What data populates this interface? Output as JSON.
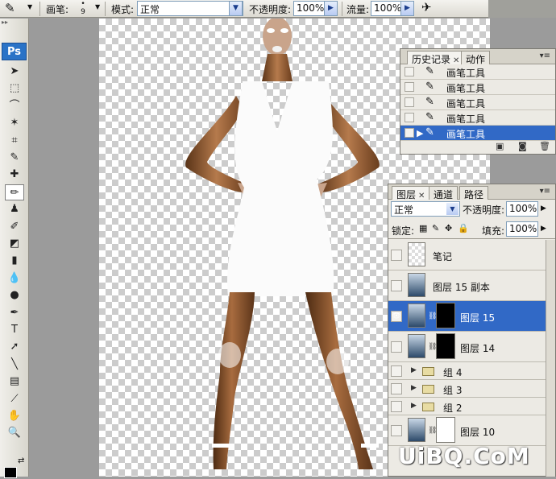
{
  "options_bar": {
    "brush_label": "画笔:",
    "brush_size": "9",
    "mode_label": "模式:",
    "mode_value": "正常",
    "opacity_label": "不透明度:",
    "opacity_value": "100%",
    "flow_label": "流量:",
    "flow_value": "100%"
  },
  "toolbox": {
    "logo": "Ps",
    "tools": [
      {
        "name": "move-tool-icon",
        "glyph": "➤"
      },
      {
        "name": "marquee-tool-icon",
        "glyph": "⬚"
      },
      {
        "name": "lasso-tool-icon",
        "glyph": "⌒"
      },
      {
        "name": "magic-wand-tool-icon",
        "glyph": "✶"
      },
      {
        "name": "crop-tool-icon",
        "glyph": "⌗"
      },
      {
        "name": "slice-tool-icon",
        "glyph": "✎"
      },
      {
        "name": "healing-brush-tool-icon",
        "glyph": "✚"
      },
      {
        "name": "brush-tool-icon",
        "glyph": "✏"
      },
      {
        "name": "clone-stamp-tool-icon",
        "glyph": "♟"
      },
      {
        "name": "history-brush-tool-icon",
        "glyph": "✐"
      },
      {
        "name": "eraser-tool-icon",
        "glyph": "◩"
      },
      {
        "name": "gradient-tool-icon",
        "glyph": "▮"
      },
      {
        "name": "blur-tool-icon",
        "glyph": "💧"
      },
      {
        "name": "dodge-tool-icon",
        "glyph": "●"
      },
      {
        "name": "pen-tool-icon",
        "glyph": "✒"
      },
      {
        "name": "type-tool-icon",
        "glyph": "T"
      },
      {
        "name": "path-selection-tool-icon",
        "glyph": "➚"
      },
      {
        "name": "line-tool-icon",
        "glyph": "╲"
      },
      {
        "name": "notes-tool-icon",
        "glyph": "▤"
      },
      {
        "name": "eyedropper-tool-icon",
        "glyph": "⟋"
      },
      {
        "name": "hand-tool-icon",
        "glyph": "✋"
      },
      {
        "name": "zoom-tool-icon",
        "glyph": "🔍"
      }
    ]
  },
  "history_panel": {
    "tabs": [
      {
        "label": "历史记录"
      },
      {
        "label": "动作"
      }
    ],
    "items": [
      {
        "label": "画笔工具"
      },
      {
        "label": "画笔工具"
      },
      {
        "label": "画笔工具"
      },
      {
        "label": "画笔工具"
      },
      {
        "label": "画笔工具"
      }
    ]
  },
  "layers_panel": {
    "tabs": [
      {
        "label": "图层"
      },
      {
        "label": "通道"
      },
      {
        "label": "路径"
      }
    ],
    "blend_mode": "正常",
    "opacity_label": "不透明度:",
    "opacity_value": "100%",
    "lock_label": "锁定:",
    "fill_label": "填充:",
    "fill_value": "100%",
    "layers": [
      {
        "name": "笔记"
      },
      {
        "name": "图层 15 副本"
      },
      {
        "name": "图层 15"
      },
      {
        "name": "图层 14"
      },
      {
        "name": "组 4"
      },
      {
        "name": "组 3"
      },
      {
        "name": "组 2"
      },
      {
        "name": "图层 10"
      }
    ]
  },
  "watermark": "UiBQ.CoM"
}
